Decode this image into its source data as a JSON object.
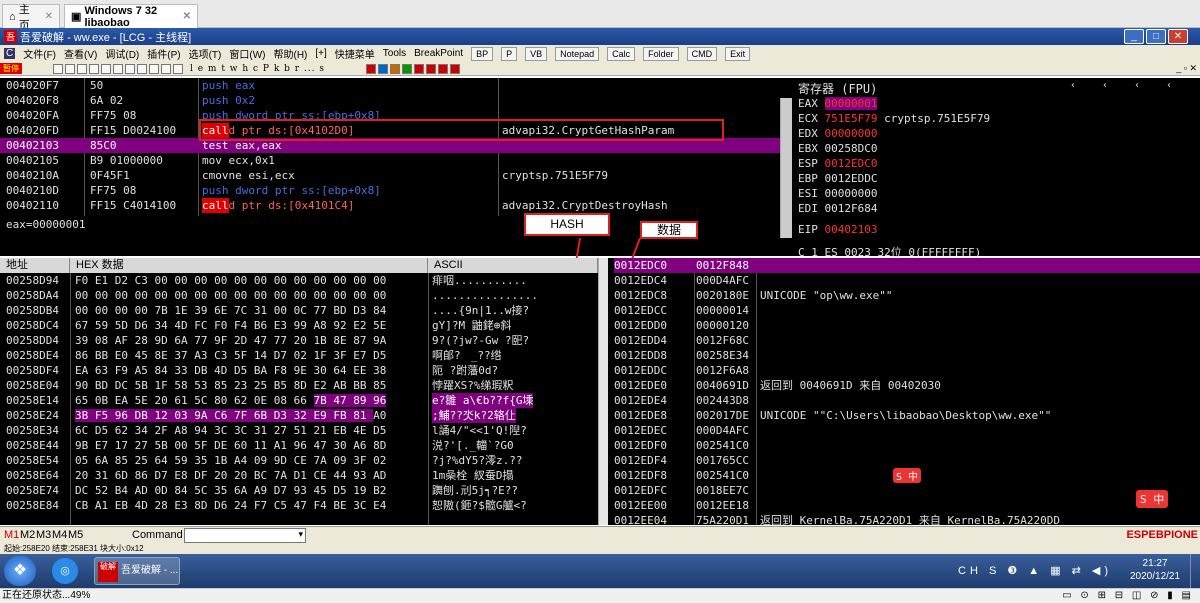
{
  "browser": {
    "tabs": [
      {
        "label": "主页"
      },
      {
        "label": "Windows 7 32 libaobao"
      }
    ]
  },
  "olly": {
    "title": "吾爱破解 - ww.exe - [LCG - 主线程]",
    "status_tag": "暂停",
    "menu": [
      "文件(F)",
      "查看(V)",
      "调试(D)",
      "插件(P)",
      "选项(T)",
      "窗口(W)",
      "帮助(H)",
      "[+]",
      "快捷菜单",
      "Tools",
      "BreakPoint"
    ],
    "tool_buttons": [
      "BP",
      "P",
      "VB",
      "Notepad",
      "Calc",
      "Folder",
      "CMD",
      "Exit"
    ],
    "toolbar_letters": "l e m t w h c P k b r ... s"
  },
  "disasm": {
    "rows": [
      {
        "addr": "004020F7",
        "hex": "50",
        "ins": "push eax",
        "type": "push",
        "cmt": ""
      },
      {
        "addr": "004020F8",
        "hex": "6A 02",
        "ins": "push 0x2",
        "type": "push",
        "cmt": ""
      },
      {
        "addr": "004020FA",
        "hex": "FF75 08",
        "ins": "push dword ptr ss:[ebp+0x8]",
        "type": "push",
        "cmt": ""
      },
      {
        "addr": "004020FD",
        "hex": "FF15 D0024100",
        "ins": "call dword ptr ds:[0x4102D0]",
        "type": "call",
        "cmt": "advapi32.CryptGetHashParam"
      },
      {
        "addr": "00402103",
        "hex": "85C0",
        "ins": "test eax,eax",
        "type": "sel",
        "cmt": ""
      },
      {
        "addr": "00402105",
        "hex": "B9 01000000",
        "ins": "mov ecx,0x1",
        "type": "normal",
        "cmt": ""
      },
      {
        "addr": "0040210A",
        "hex": "0F45F1",
        "ins": "cmovne esi,ecx",
        "type": "normal",
        "cmt": "cryptsp.751E5F79"
      },
      {
        "addr": "0040210D",
        "hex": "FF75 08",
        "ins": "push dword ptr ss:[ebp+0x8]",
        "type": "push",
        "cmt": ""
      },
      {
        "addr": "00402110",
        "hex": "FF15 C4014100",
        "ins": "call dword ptr ds:[0x4101C4]",
        "type": "call",
        "cmt": "advapi32.CryptDestroyHash"
      }
    ],
    "info": "eax=00000001"
  },
  "annotations": {
    "hash": "HASH",
    "data": "数据"
  },
  "registers": {
    "title": "寄存器 (FPU)",
    "rows": [
      {
        "name": "EAX",
        "value": "00000001",
        "note": "",
        "hl": "sel"
      },
      {
        "name": "ECX",
        "value": "751E5F79",
        "note": "cryptsp.751E5F79",
        "hl": "red"
      },
      {
        "name": "EDX",
        "value": "00000000",
        "note": "",
        "hl": "red"
      },
      {
        "name": "EBX",
        "value": "00258DC0",
        "note": "",
        "hl": ""
      },
      {
        "name": "ESP",
        "value": "0012EDC0",
        "note": "",
        "hl": "red"
      },
      {
        "name": "EBP",
        "value": "0012EDDC",
        "note": "",
        "hl": ""
      },
      {
        "name": "ESI",
        "value": "00000000",
        "note": "",
        "hl": ""
      },
      {
        "name": "EDI",
        "value": "0012F684",
        "note": "",
        "hl": ""
      }
    ],
    "eip_name": "EIP",
    "eip": "00402103",
    "flags": "C 1  ES 0023 32位 0(FFFFFFFF)"
  },
  "dump": {
    "headers": [
      "地址",
      "HEX 数据",
      "ASCII"
    ],
    "rows": [
      {
        "addr": "00258D94",
        "hex": "F0 E1 D2 C3 00 00 00 00 00 00 00 00 00 00 00 00",
        "ascii": "痱咽..........."
      },
      {
        "addr": "00258DA4",
        "hex": "00 00 00 00 00 00 00 00 00 00 00 00 00 00 00 00",
        "ascii": "................"
      },
      {
        "addr": "00258DB4",
        "hex": "00 00 00 00 7B 1E 39 6E 7C 31 00 0C 77 BD D3 84",
        "ascii": "....{9n|1..w接?"
      },
      {
        "addr": "00258DC4",
        "hex": "67 59 5D D6 34 4D FC F0 F4 B6 E3 99 A8 92 E2 5E",
        "ascii": "gY]?M  鼬銠⊕斜"
      },
      {
        "addr": "00258DD4",
        "hex": "39 08 AF 28 9D 6A 77 9F 2D 47 77 20 1B 8E 87 9A",
        "ascii": "9?(?jw?-Gw ?巸?"
      },
      {
        "addr": "00258DE4",
        "hex": "86 BB E0 45 8E 37 A3 C3 5F 14 D7 02 1F 3F E7 D5",
        "ascii": "啊郋?ﾠ_??绺"
      },
      {
        "addr": "00258DF4",
        "hex": "EA 63 F9 A5 84 33 DB 4D D5 BA F8 9E 30 64 EE 38",
        "ascii": "阨  ?跗藩0d?"
      },
      {
        "addr": "00258E04",
        "hex": "90 BD DC 5B 1F 58 53 85 23 25 B5 8D E2 AB BB 85",
        "ascii": "悖躍XS?%绨瑕粎"
      },
      {
        "addr": "00258E14",
        "hex": "65 0B EA 5E 20 61 5C 80 62 0E 08 66 7B 47 89 96",
        "ascii": "e?雛 a\\€b??f{G塖",
        "hl_from": 12
      },
      {
        "addr": "00258E24",
        "hex": "3B F5 96 DB 12 03 9A C6 7F 6B D3 32 E9 FB 81 A0",
        "ascii": ";鯆??氼k?2辂仩",
        "hl_to": 14
      },
      {
        "addr": "00258E34",
        "hex": "6C D5 62 34 2F A8 94 3C 3C 31 27 51 21 EB 4E D5",
        "ascii": "l誦4/\"<<1'Q!隉?"
      },
      {
        "addr": "00258E44",
        "hex": "9B E7 17 27 5B 00 5F DE 60 11 A1 96 47 30 A6 8D",
        "ascii": "涚?'[._輺`?G0"
      },
      {
        "addr": "00258E54",
        "hex": "05 6A 85 25 64 59 35 1B A4 09 9D CE 7A 09 3F 02",
        "ascii": "?j?%dY5?澪z.??"
      },
      {
        "addr": "00258E64",
        "hex": "20 31 6D 86 D7 E8 DF 20 20 BC 7A D1 CE 44 93 AD",
        "ascii": " 1m喿栓  紁蚕D搨"
      },
      {
        "addr": "00258E74",
        "hex": "DC 52 B4 AD 0D 84 5C 35 6A A9 D7 93 45 D5 19 B2",
        "ascii": "躌刨.刓5j┑?E??"
      },
      {
        "addr": "00258E84",
        "hex": "CB A1 EB 4D 28 E3 8D D6 24 F7 C5 47 F4 BE 3C E4",
        "ascii": "恕隞(鉔?$髋G艫<?"
      }
    ]
  },
  "stack": {
    "rows": [
      {
        "addr": "0012EDC0",
        "val": "0012F848",
        "cmt": "",
        "sel": true
      },
      {
        "addr": "0012EDC4",
        "val": "000D4AFC",
        "cmt": ""
      },
      {
        "addr": "0012EDC8",
        "val": "0020180E",
        "cmt": "UNICODE \"op\\ww.exe\"\""
      },
      {
        "addr": "0012EDCC",
        "val": "00000014",
        "cmt": ""
      },
      {
        "addr": "0012EDD0",
        "val": "00000120",
        "cmt": ""
      },
      {
        "addr": "0012EDD4",
        "val": "0012F68C",
        "cmt": ""
      },
      {
        "addr": "0012EDD8",
        "val": "00258E34",
        "cmt": ""
      },
      {
        "addr": "0012EDDC",
        "val": "0012F6A8",
        "cmt": ""
      },
      {
        "addr": "0012EDE0",
        "val": "0040691D",
        "cmt": "返回到 0040691D 来自 00402030"
      },
      {
        "addr": "0012EDE4",
        "val": "002443D8",
        "cmt": ""
      },
      {
        "addr": "0012EDE8",
        "val": "002017DE",
        "cmt": "UNICODE \"\"C:\\Users\\libaobao\\Desktop\\ww.exe\"\""
      },
      {
        "addr": "0012EDEC",
        "val": "000D4AFC",
        "cmt": ""
      },
      {
        "addr": "0012EDF0",
        "val": "002541C0",
        "cmt": ""
      },
      {
        "addr": "0012EDF4",
        "val": "001765CC",
        "cmt": ""
      },
      {
        "addr": "0012EDF8",
        "val": "002541C0",
        "cmt": ""
      },
      {
        "addr": "0012EDFC",
        "val": "0018EE7C",
        "cmt": ""
      },
      {
        "addr": "0012EE00",
        "val": "0012EE18",
        "cmt": ""
      },
      {
        "addr": "0012EE04",
        "val": "75A220D1",
        "cmt": "返回到 KernelBa.75A220D1 来自 KernelBa.75A220DD"
      }
    ]
  },
  "cmd": {
    "tabs": [
      "M1",
      "M2",
      "M3",
      "M4",
      "M5"
    ],
    "label": "Command",
    "right": "ESPEBPIONE"
  },
  "statusline": "起始:258E20 结束:258E31 块大小:0x12",
  "taskbar": {
    "app": "吾爱破解 - ...",
    "time": "21:27",
    "date": "2020/12/21"
  },
  "bottom": {
    "status": "正在还原状态...49%"
  }
}
